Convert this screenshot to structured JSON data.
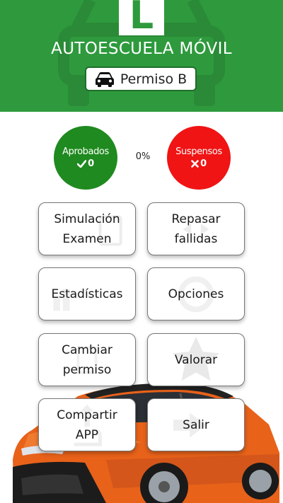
{
  "header": {
    "badge_letter": "L",
    "title": "AUTOESCUELA MÓVIL",
    "permit_label": "Permiso B",
    "permit_icon": "car-icon"
  },
  "stats": {
    "approved_label": "Aprobados",
    "approved_count": "0",
    "percentage": "0%",
    "failed_label": "Suspensos",
    "failed_count": "0"
  },
  "menu": {
    "simulation": "Simulación\nExamen",
    "review": "Repasar\nfallidas",
    "statistics": "Estadísticas",
    "options": "Opciones",
    "change_permit": "Cambiar\npermiso",
    "rate": "Valorar",
    "share": "Compartir\nAPP",
    "exit": "Salir"
  },
  "colors": {
    "header_green": "#2e9a3d",
    "approved_green": "#1f8a1f",
    "failed_red": "#f01414",
    "car_orange": "#e8621a"
  }
}
